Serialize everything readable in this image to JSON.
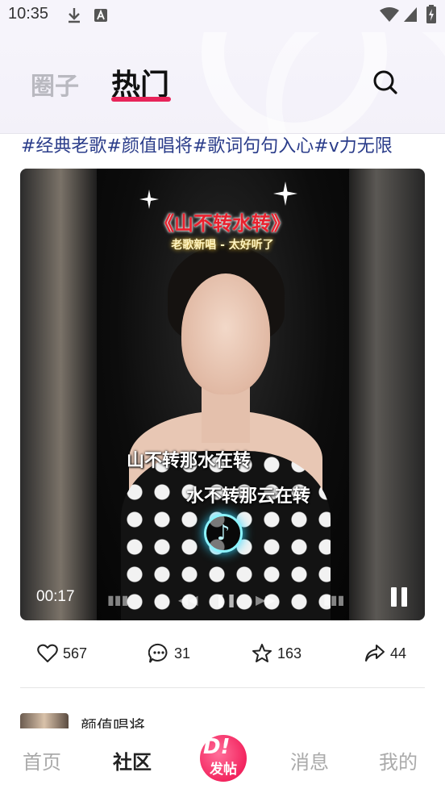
{
  "status_bar": {
    "time": "10:35"
  },
  "header": {
    "tabs": [
      {
        "label": "圈子",
        "active": false
      },
      {
        "label": "热门",
        "active": true
      }
    ],
    "accent_color": "#e8245a"
  },
  "post": {
    "hashtags": "#经典老歌#颜值唱将#歌词句句入心#v力无限",
    "video": {
      "song_title": "《山不转水转》",
      "subtitle": "老歌新唱 - 太好听了",
      "lyric_line_1": "山不转那水在转",
      "lyric_line_2": "水不转那云在转",
      "time": "00:17",
      "logo_glyph": "♪"
    },
    "actions": {
      "likes": "567",
      "comments": "31",
      "favorites": "163",
      "shares": "44"
    }
  },
  "next_post": {
    "author": "颜值唱将"
  },
  "bottom_nav": {
    "items": [
      {
        "label": "首页",
        "active": false
      },
      {
        "label": "社区",
        "active": true
      },
      {
        "label": "消息",
        "active": false
      },
      {
        "label": "我的",
        "active": false
      }
    ],
    "post_button_label": "发帖",
    "post_button_color": "#f3255f"
  }
}
